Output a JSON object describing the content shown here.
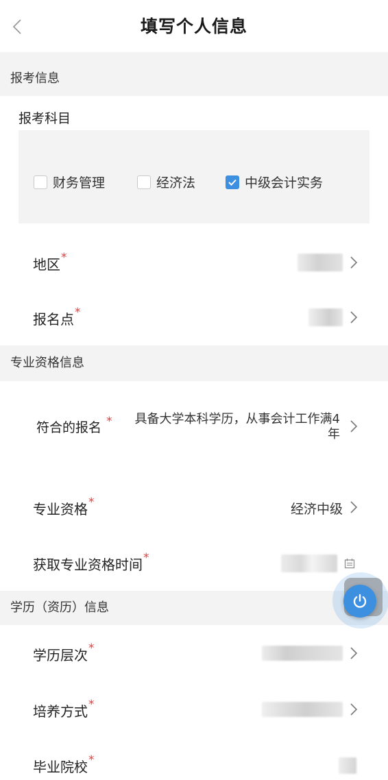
{
  "header": {
    "title": "填写个人信息"
  },
  "sections": {
    "exam": "报考信息",
    "qualification": "专业资格信息",
    "education": "学历（资历）信息"
  },
  "subjects": {
    "label": "报考科目",
    "items": [
      {
        "label": "财务管理",
        "checked": false
      },
      {
        "label": "经济法",
        "checked": false
      },
      {
        "label": "中级会计实务",
        "checked": true
      }
    ]
  },
  "fields": {
    "region": {
      "label": "地区",
      "required": "*"
    },
    "site": {
      "label": "报名点",
      "required": "*"
    },
    "eligibility": {
      "label": "符合的报名",
      "required": "*",
      "value_line1": "具备大学本科学历，从事会计工作满4",
      "value_line2": "年"
    },
    "qualification": {
      "label": "专业资格",
      "required": "*",
      "value": "经济中级"
    },
    "qualification_time": {
      "label": "获取专业资格时间",
      "required": "*"
    },
    "education_level": {
      "label": "学历层次",
      "required": "*"
    },
    "training_mode": {
      "label": "培养方式",
      "required": "*"
    },
    "school": {
      "label": "毕业院校",
      "required": "*"
    }
  },
  "icons": {
    "back": "chevron-left-icon",
    "chevron": "chevron-right-icon",
    "calendar": "calendar-icon",
    "power": "power-icon"
  },
  "colors": {
    "accent": "#3d8fe0",
    "required": "#e23c3c",
    "section_bg": "#f3f3f3"
  }
}
